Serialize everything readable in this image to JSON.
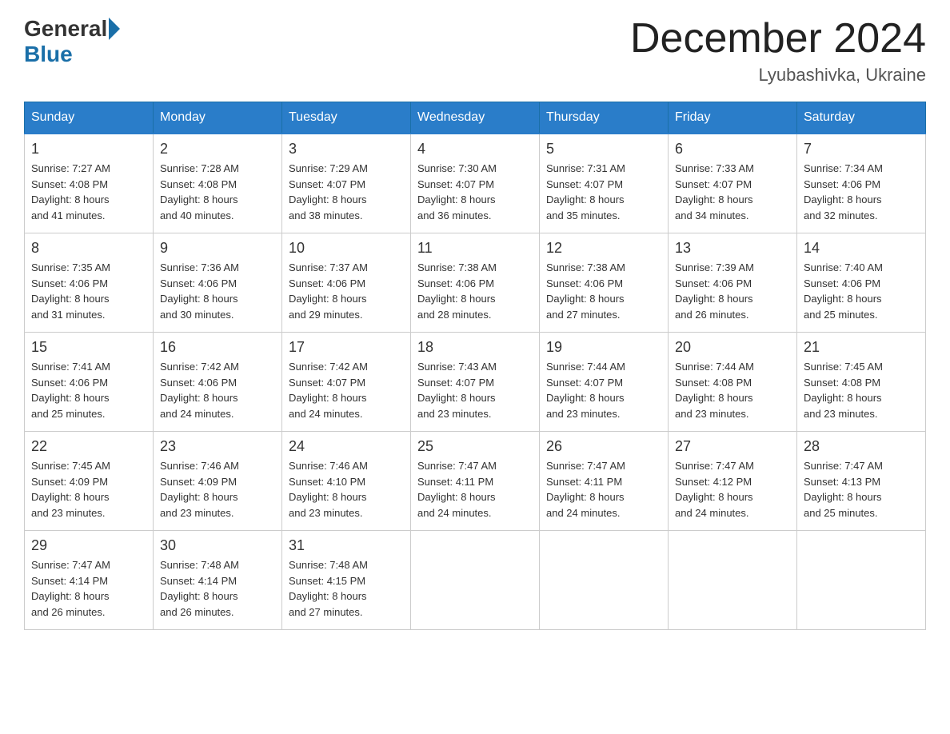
{
  "header": {
    "logo_general": "General",
    "logo_blue": "Blue",
    "month_title": "December 2024",
    "location": "Lyubashivka, Ukraine"
  },
  "weekdays": [
    "Sunday",
    "Monday",
    "Tuesday",
    "Wednesday",
    "Thursday",
    "Friday",
    "Saturday"
  ],
  "weeks": [
    [
      {
        "day": "1",
        "sunrise": "7:27 AM",
        "sunset": "4:08 PM",
        "daylight": "8 hours and 41 minutes."
      },
      {
        "day": "2",
        "sunrise": "7:28 AM",
        "sunset": "4:08 PM",
        "daylight": "8 hours and 40 minutes."
      },
      {
        "day": "3",
        "sunrise": "7:29 AM",
        "sunset": "4:07 PM",
        "daylight": "8 hours and 38 minutes."
      },
      {
        "day": "4",
        "sunrise": "7:30 AM",
        "sunset": "4:07 PM",
        "daylight": "8 hours and 36 minutes."
      },
      {
        "day": "5",
        "sunrise": "7:31 AM",
        "sunset": "4:07 PM",
        "daylight": "8 hours and 35 minutes."
      },
      {
        "day": "6",
        "sunrise": "7:33 AM",
        "sunset": "4:07 PM",
        "daylight": "8 hours and 34 minutes."
      },
      {
        "day": "7",
        "sunrise": "7:34 AM",
        "sunset": "4:06 PM",
        "daylight": "8 hours and 32 minutes."
      }
    ],
    [
      {
        "day": "8",
        "sunrise": "7:35 AM",
        "sunset": "4:06 PM",
        "daylight": "8 hours and 31 minutes."
      },
      {
        "day": "9",
        "sunrise": "7:36 AM",
        "sunset": "4:06 PM",
        "daylight": "8 hours and 30 minutes."
      },
      {
        "day": "10",
        "sunrise": "7:37 AM",
        "sunset": "4:06 PM",
        "daylight": "8 hours and 29 minutes."
      },
      {
        "day": "11",
        "sunrise": "7:38 AM",
        "sunset": "4:06 PM",
        "daylight": "8 hours and 28 minutes."
      },
      {
        "day": "12",
        "sunrise": "7:38 AM",
        "sunset": "4:06 PM",
        "daylight": "8 hours and 27 minutes."
      },
      {
        "day": "13",
        "sunrise": "7:39 AM",
        "sunset": "4:06 PM",
        "daylight": "8 hours and 26 minutes."
      },
      {
        "day": "14",
        "sunrise": "7:40 AM",
        "sunset": "4:06 PM",
        "daylight": "8 hours and 25 minutes."
      }
    ],
    [
      {
        "day": "15",
        "sunrise": "7:41 AM",
        "sunset": "4:06 PM",
        "daylight": "8 hours and 25 minutes."
      },
      {
        "day": "16",
        "sunrise": "7:42 AM",
        "sunset": "4:06 PM",
        "daylight": "8 hours and 24 minutes."
      },
      {
        "day": "17",
        "sunrise": "7:42 AM",
        "sunset": "4:07 PM",
        "daylight": "8 hours and 24 minutes."
      },
      {
        "day": "18",
        "sunrise": "7:43 AM",
        "sunset": "4:07 PM",
        "daylight": "8 hours and 23 minutes."
      },
      {
        "day": "19",
        "sunrise": "7:44 AM",
        "sunset": "4:07 PM",
        "daylight": "8 hours and 23 minutes."
      },
      {
        "day": "20",
        "sunrise": "7:44 AM",
        "sunset": "4:08 PM",
        "daylight": "8 hours and 23 minutes."
      },
      {
        "day": "21",
        "sunrise": "7:45 AM",
        "sunset": "4:08 PM",
        "daylight": "8 hours and 23 minutes."
      }
    ],
    [
      {
        "day": "22",
        "sunrise": "7:45 AM",
        "sunset": "4:09 PM",
        "daylight": "8 hours and 23 minutes."
      },
      {
        "day": "23",
        "sunrise": "7:46 AM",
        "sunset": "4:09 PM",
        "daylight": "8 hours and 23 minutes."
      },
      {
        "day": "24",
        "sunrise": "7:46 AM",
        "sunset": "4:10 PM",
        "daylight": "8 hours and 23 minutes."
      },
      {
        "day": "25",
        "sunrise": "7:47 AM",
        "sunset": "4:11 PM",
        "daylight": "8 hours and 24 minutes."
      },
      {
        "day": "26",
        "sunrise": "7:47 AM",
        "sunset": "4:11 PM",
        "daylight": "8 hours and 24 minutes."
      },
      {
        "day": "27",
        "sunrise": "7:47 AM",
        "sunset": "4:12 PM",
        "daylight": "8 hours and 24 minutes."
      },
      {
        "day": "28",
        "sunrise": "7:47 AM",
        "sunset": "4:13 PM",
        "daylight": "8 hours and 25 minutes."
      }
    ],
    [
      {
        "day": "29",
        "sunrise": "7:47 AM",
        "sunset": "4:14 PM",
        "daylight": "8 hours and 26 minutes."
      },
      {
        "day": "30",
        "sunrise": "7:48 AM",
        "sunset": "4:14 PM",
        "daylight": "8 hours and 26 minutes."
      },
      {
        "day": "31",
        "sunrise": "7:48 AM",
        "sunset": "4:15 PM",
        "daylight": "8 hours and 27 minutes."
      },
      null,
      null,
      null,
      null
    ]
  ],
  "labels": {
    "sunrise": "Sunrise:",
    "sunset": "Sunset:",
    "daylight": "Daylight:"
  }
}
